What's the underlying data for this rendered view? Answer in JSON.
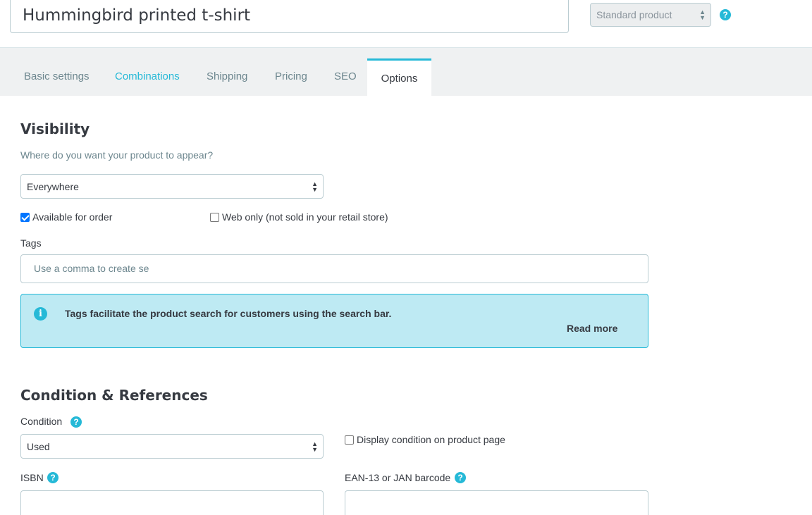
{
  "header": {
    "product_name": "Hummingbird printed t-shirt",
    "product_type": "Standard product",
    "help_glyph": "?"
  },
  "tabs": [
    {
      "label": "Basic settings"
    },
    {
      "label": "Combinations"
    },
    {
      "label": "Shipping"
    },
    {
      "label": "Pricing"
    },
    {
      "label": "SEO"
    },
    {
      "label": "Options"
    }
  ],
  "active_tab": "Options",
  "visibility": {
    "title": "Visibility",
    "question": "Where do you want your product to appear?",
    "selected": "Everywhere",
    "available_for_order": {
      "label": "Available for order",
      "checked": true
    },
    "web_only": {
      "label": "Web only (not sold in your retail store)",
      "checked": false
    },
    "tags_label": "Tags",
    "tags_placeholder": "Use a comma to create se",
    "info": {
      "icon": "info-icon",
      "message": "Tags facilitate the product search for customers using the search bar.",
      "link": "Read more"
    }
  },
  "condition": {
    "title": "Condition & References",
    "label": "Condition",
    "selected": "Used",
    "display_on_page": {
      "label": "Display condition on product page",
      "checked": false
    },
    "isbn_label": "ISBN",
    "ean_label": "EAN-13 or JAN barcode"
  },
  "colors": {
    "accent": "#25b9d7",
    "info_bg": "#beeaf3",
    "text": "#363a41",
    "muted": "#6c868e"
  }
}
